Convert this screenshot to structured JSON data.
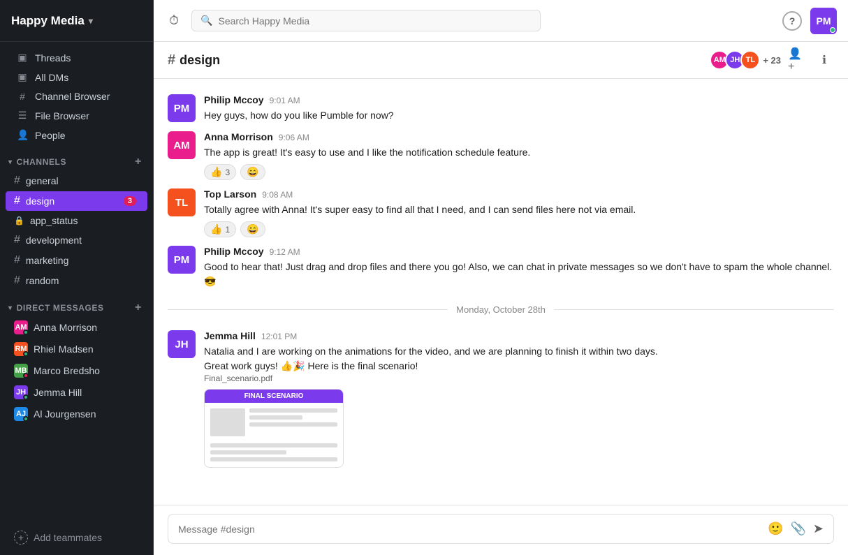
{
  "workspace": {
    "name": "Happy Media",
    "chevron": "▾"
  },
  "sidebar": {
    "nav_items": [
      {
        "id": "threads",
        "icon": "▣",
        "label": "Threads"
      },
      {
        "id": "all-dms",
        "icon": "▣",
        "label": "All DMs"
      },
      {
        "id": "channel-browser",
        "icon": "#",
        "label": "Channel Browser"
      },
      {
        "id": "file-browser",
        "icon": "☰",
        "label": "File Browser"
      },
      {
        "id": "people",
        "icon": "👤",
        "label": "People"
      }
    ],
    "channels_section": {
      "label": "CHANNELS",
      "items": [
        {
          "id": "general",
          "name": "general",
          "type": "public",
          "active": false,
          "badge": null
        },
        {
          "id": "design",
          "name": "design",
          "type": "public",
          "active": true,
          "badge": "3"
        },
        {
          "id": "app_status",
          "name": "app_status",
          "type": "private",
          "active": false,
          "badge": null
        },
        {
          "id": "development",
          "name": "development",
          "type": "public",
          "active": false,
          "badge": null
        },
        {
          "id": "marketing",
          "name": "marketing",
          "type": "public",
          "active": false,
          "badge": null
        },
        {
          "id": "random",
          "name": "random",
          "type": "public",
          "active": false,
          "badge": null
        }
      ]
    },
    "dm_section": {
      "label": "DIRECT MESSAGES",
      "items": [
        {
          "id": "anna-morrison",
          "name": "Anna Morrison",
          "color": "#e91e8c",
          "status": "online"
        },
        {
          "id": "rhiel-madsen",
          "name": "Rhiel Madsen",
          "color": "#f4511e",
          "status": "online"
        },
        {
          "id": "marco-bredsho",
          "name": "Marco Bredsho",
          "color": "#43a047",
          "status": "away"
        },
        {
          "id": "jemma-hill",
          "name": "Jemma Hill",
          "color": "#7c3aed",
          "status": "online"
        },
        {
          "id": "al-jourgensen",
          "name": "Al Jourgensen",
          "color": "#1e88e5",
          "status": "online"
        }
      ]
    },
    "add_teammates": "Add teammates"
  },
  "topbar": {
    "search_placeholder": "Search Happy Media",
    "help_label": "?"
  },
  "channel_header": {
    "hash": "#",
    "name": "design",
    "member_count": "+ 23",
    "add_member_icon": "➕",
    "info_icon": "ℹ"
  },
  "messages": [
    {
      "id": "msg1",
      "author": "Philip Mccoy",
      "time": "9:01 AM",
      "text": "Hey guys, how do you like Pumble for now?",
      "reactions": [],
      "avatar_color": "#7c3aed",
      "avatar_initials": "PM"
    },
    {
      "id": "msg2",
      "author": "Anna Morrison",
      "time": "9:06 AM",
      "text": "The app is great! It's easy to use and I like the notification schedule feature.",
      "reactions": [
        {
          "emoji": "👍",
          "count": "3"
        },
        {
          "emoji": "😄",
          "count": null
        }
      ],
      "avatar_color": "#e91e8c",
      "avatar_initials": "AM"
    },
    {
      "id": "msg3",
      "author": "Top Larson",
      "time": "9:08 AM",
      "text": "Totally agree with Anna! It's super easy to find all that I need, and I can send files here not via email.",
      "reactions": [
        {
          "emoji": "👍",
          "count": "1"
        },
        {
          "emoji": "😄",
          "count": null
        }
      ],
      "avatar_color": "#f4511e",
      "avatar_initials": "TL"
    },
    {
      "id": "msg4",
      "author": "Philip Mccoy",
      "time": "9:12 AM",
      "text": "Good to hear that! Just drag and drop files and there you go! Also, we can chat in private messages so we don't have to spam the whole channel. 😎",
      "reactions": [],
      "avatar_color": "#7c3aed",
      "avatar_initials": "PM"
    }
  ],
  "date_divider": "Monday, October 28th",
  "jemma_message": {
    "author": "Jemma Hill",
    "time": "12:01 PM",
    "line1": "Natalia and I are working on the animations for the video, and we are planning to finish it within two days.",
    "line2": "Great work guys! 👍🎉  Here is the final scenario!",
    "attachment_name": "Final_scenario.pdf",
    "attachment_header": "FINAL SCENARIO",
    "avatar_color": "#7c3aed",
    "avatar_initials": "JH"
  },
  "message_input": {
    "placeholder": "Message #design"
  }
}
